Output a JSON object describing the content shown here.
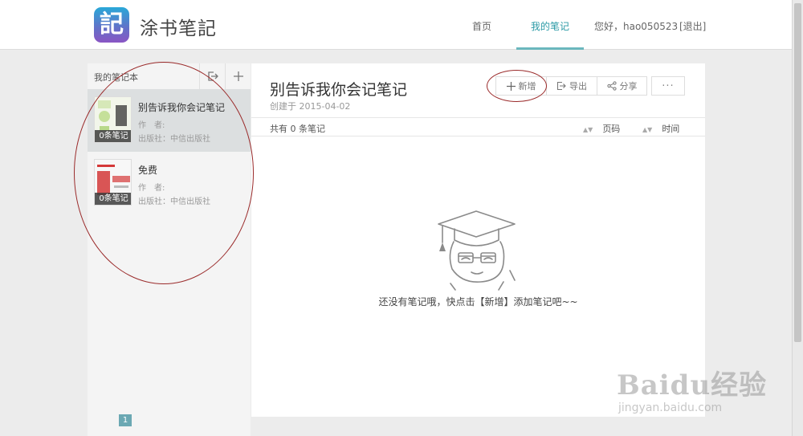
{
  "header": {
    "logo_glyph": "記",
    "app_name": "涂书笔記",
    "nav": [
      {
        "label": "首页"
      },
      {
        "label": "我的笔记"
      }
    ],
    "greeting": "您好，hao050523",
    "logout": "[退出]"
  },
  "sidebar": {
    "title": "我的笔记本",
    "items": [
      {
        "title": "别告诉我你会记笔记",
        "author": "作　者:",
        "publisher": "出版社：中信出版社",
        "count": "0条笔记"
      },
      {
        "title": "免费",
        "author": "作　者:",
        "publisher": "出版社：中信出版社",
        "count": "0条笔记"
      }
    ],
    "page": "1"
  },
  "main": {
    "title": "别告诉我你会记笔记",
    "created": "创建于 2015-04-02",
    "toolbar": {
      "add": "新增",
      "export": "导出",
      "share": "分享",
      "more": "···"
    },
    "list": {
      "count": "共有 0 条笔记",
      "col_page": "页码",
      "col_time": "时间"
    },
    "empty_message": "还没有笔记哦，快点击【新增】添加笔记吧~~"
  },
  "watermark": {
    "brand": "Baidu经验",
    "url": "jingyan.baidu.com"
  },
  "colors": {
    "accent": "#2b9aa6",
    "annotation": "#9a2a2a"
  }
}
